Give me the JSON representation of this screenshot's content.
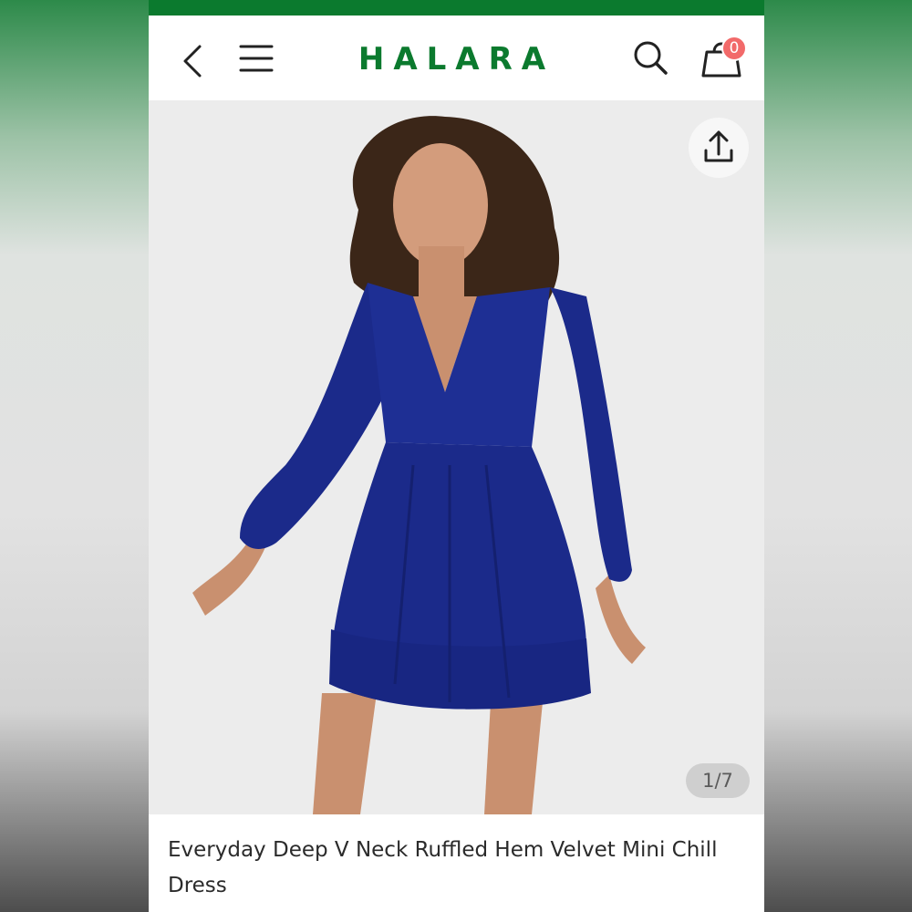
{
  "header": {
    "brand": "HALARA",
    "cart_count": "0",
    "back_icon": "chevron-left-icon",
    "menu_icon": "hamburger-menu-icon",
    "search_icon": "search-icon",
    "cart_icon": "shopping-bag-icon"
  },
  "gallery": {
    "share_icon": "share-upload-icon",
    "counter": "1/7",
    "image_alt": "Model wearing a navy blue velvet long-sleeve deep V neck mini dress with ruffled hem"
  },
  "product": {
    "title": "Everyday Deep V Neck Ruffled Hem Velvet Mini Chill Dress"
  },
  "colors": {
    "brand_green": "#0b7a2e",
    "badge_red": "#f26a6a",
    "dress_blue": "#1b2a8a"
  }
}
